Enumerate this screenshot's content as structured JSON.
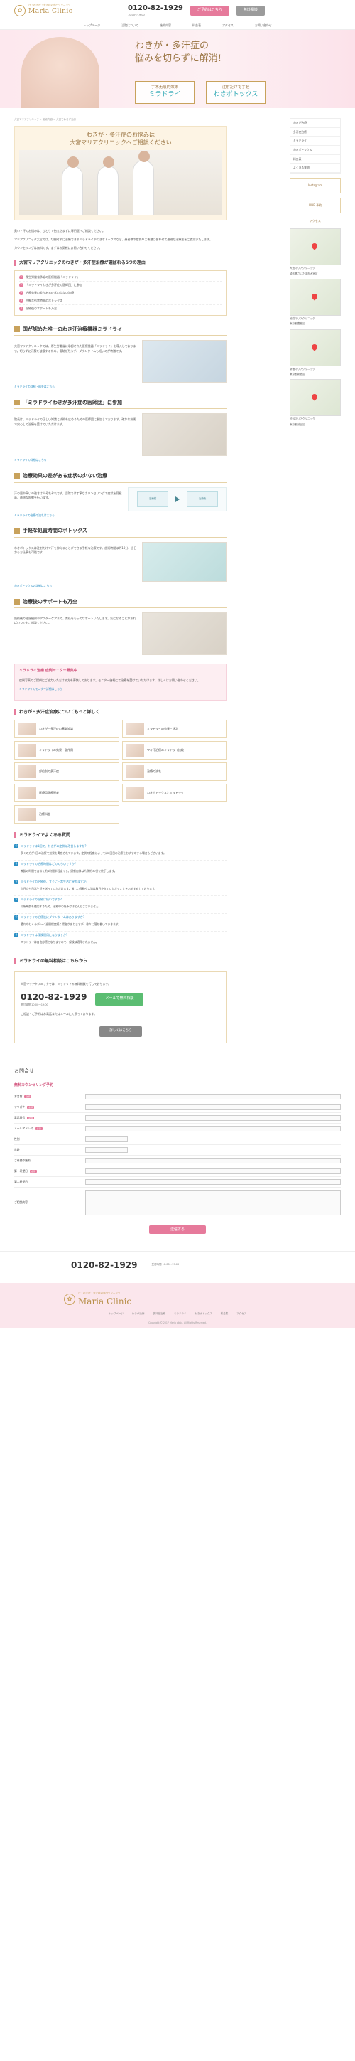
{
  "header": {
    "logo_sub": "汗・わきが・多汗症の専門クリニック",
    "logo_main": "Maria Clinic",
    "tel": "0120-82-1929",
    "hours": "10:00〜19:00",
    "reserve_label": "ご予約はこちら",
    "consult_label": "無料相談"
  },
  "gnav": [
    "トップページ",
    "当院について",
    "施術内容",
    "料金表",
    "アクセス",
    "お問い合わせ"
  ],
  "hero": {
    "title_l1": "わきが・多汗症の",
    "title_l2": "悩みを切らずに解消!",
    "card1_small": "手术无痕的效果",
    "card1_big": "ミラドライ",
    "card2_small": "注射だけで手軽",
    "card2_big": "わきボトックス"
  },
  "breadcrumb": "大宮マリアクリニック > 施術内容 > 大宮でわきが治療",
  "intro": {
    "title_l1": "わきが・多汗症のお悩みは",
    "title_l2": "大宮マリアクリニックへご相談ください",
    "p1": "臭い・汗のお悩みは、ひとりで抱え込まずに専門医へご相談ください。",
    "p2": "マリアクリニック大宮では、切開せずに治療できるミラドライやわきボトックスなど、患者様の症状やご希望に合わせて最適な治療法をご提案いたします。",
    "p3": "カウンセリングは無料です。まずはお気軽にお問い合わせください。"
  },
  "reasons": {
    "heading": "大宮マリアクリニックのわきが・多汗症治療が選ばれる5つの理由",
    "items": [
      "厚生労働省承認の医療機器「ミラドライ」",
      "「ミラドライわきが多汗症の医師団」に参加",
      "治療効果の差がある症状の少ない治療",
      "手軽な処置時間のボトックス",
      "治療後のサポートも万全"
    ]
  },
  "sections": [
    {
      "title": "国が認めた唯一のわき汗治療機器ミラドライ",
      "text": "大宮マリアクリニックでは、厚生労働省に承認された医療機器「ミラドライ」を導入しております。切らずに汗腺を破壊するため、傷跡が残らず、ダウンタイムも短いのが特徴です。",
      "link": "ミラドライの詳細・料金はこちら"
    },
    {
      "title": "「ミラドライわきが多汗症の医師団」に参加",
      "text": "院長は、ミラドライの正しい知識と技術を広めるための医師団に参加しております。確かな技術で安心して治療を受けていただけます。",
      "link": "ミラドライの詳細はこちら"
    },
    {
      "title": "治療効果の差がある症状の少ない治療",
      "text": "汗の量や臭いの強さは人それぞれです。当院では丁寧なカウンセリングで症状を見極め、最適な照射を行います。",
      "link": "ミラドライの治療の流れはこちら",
      "before": "治療前",
      "after": "治療後"
    },
    {
      "title": "手軽な処置時間のボトックス",
      "text": "わきボトックスは注射だけで汗を抑えることができる手軽な治療です。施術時間は約10分、当日からお仕事も可能です。",
      "link": "わきボトックスの詳細はこちら"
    },
    {
      "title": "治療後のサポートも万全",
      "text": "施術後の経過観察やアフターケアまで、責任をもってサポートいたします。気になることがあればいつでもご相談ください。",
      "link": ""
    }
  ],
  "monitor": {
    "title": "ミラドライ治療 症例モニター募集中",
    "text": "症例写真のご提供にご協力いただける方を募集しております。モニター価格にて治療を受けていただけます。詳しくはお問い合わせください。",
    "link": "ミラドライのモニター詳細はこちら"
  },
  "treatments": {
    "heading": "わきが・多汗症治療についてもっと詳しく",
    "items": [
      "わきが・多汗症の基礎知識",
      "ミラドライの効果・評判",
      "ミラドライの効果・副作用",
      "ワキ汗治療のミラドライ比較",
      "部位別の多汗症",
      "治療の流れ",
      "医療用医療脱毛",
      "わきボトックスとミラドライ",
      "治療料金"
    ]
  },
  "faq": {
    "heading": "ミラドライでよくある質問",
    "items": [
      {
        "q": "ミラドライは1回で、わきがの症状は改善しますか?",
        "a": "多くの方が1回の治療で効果を実感されています。症状の程度によっては2回目の治療をおすすめする場合もございます。"
      },
      {
        "q": "ミラドライの治療時間はどのくらいですか?",
        "a": "麻酔の時間を含めて約1時間半程度です。照射自体は片側約30分で終了します。"
      },
      {
        "q": "ミラドライの治療後、すぐに日常生活に戻れますか?",
        "a": "当日から日常生活を送っていただけます。激しい運動や入浴は数日控えていただくことをおすすめしております。"
      },
      {
        "q": "ミラドライの治療は痛いですか?",
        "a": "局所麻酔を使用するため、治療中の痛みはほとんどございません。"
      },
      {
        "q": "ミラドライの治療後にダウンタイムはありますか?",
        "a": "腫れやむくみが1〜2週間程度続く場合がありますが、徐々に落ち着いていきます。"
      },
      {
        "q": "ミラドライは保険適用になりますか?",
        "a": "ミラドライは自由診療となりますので、保険は適用されません。"
      }
    ]
  },
  "contact": {
    "heading": "ミラドライの無料相談はこちらから",
    "lead": "大宮マリアクリニックでは、ミラドライの無料相談を行っております。",
    "tel": "0120-82-1929",
    "hours": "受付時間 10:00〜19:00",
    "mail_label": "メールで無料相談",
    "note": "ご相談・ご予約はお電話またはメールにて承っております。",
    "more_label": "詳しくはこちら"
  },
  "sidebar": {
    "menu": [
      "わきが治療",
      "多汗症治療",
      "ミラドライ",
      "わきボトックス",
      "料金表",
      "よくある質問"
    ],
    "banner_insta": "Instagram",
    "banner_line": "LINE 予約",
    "access_title": "アクセス",
    "branches": [
      {
        "name": "大宮マリアクリニック",
        "addr": "埼玉県さいたま市大宮区"
      },
      {
        "name": "池袋マリアクリニック",
        "addr": "東京都豊島区"
      },
      {
        "name": "新宿マリアクリニック",
        "addr": "東京都新宿区"
      },
      {
        "name": "渋谷マリアクリニック",
        "addr": "東京都渋谷区"
      }
    ]
  },
  "form": {
    "title": "お問合せ",
    "subtitle": "無料カウンセリング予約",
    "rows": [
      {
        "label": "お名前",
        "req": "必須"
      },
      {
        "label": "フリガナ",
        "req": "必須"
      },
      {
        "label": "電話番号",
        "req": "必須"
      },
      {
        "label": "メールアドレス",
        "req": "必須"
      },
      {
        "label": "性別",
        "req": ""
      },
      {
        "label": "年齢",
        "req": ""
      },
      {
        "label": "ご希望の施術",
        "req": ""
      },
      {
        "label": "第一希望日",
        "req": "必須"
      },
      {
        "label": "第二希望日",
        "req": ""
      },
      {
        "label": "ご相談内容",
        "req": ""
      }
    ],
    "req_badge": "必須",
    "submit_label": "送信する"
  },
  "bottom": {
    "tel": "0120-82-1929",
    "hours": "受付時間 10:00〜19:00"
  },
  "footer": {
    "logo_sub": "汗・わきが・多汗症の専門クリニック",
    "logo_main": "Maria Clinic",
    "links": [
      "トップページ",
      "わきが治療",
      "多汗症治療",
      "ミラドライ",
      "わきボトックス",
      "料金表",
      "アクセス"
    ],
    "copyright": "Copyright © 2017 Maria clinic. All Rights Reserved."
  }
}
